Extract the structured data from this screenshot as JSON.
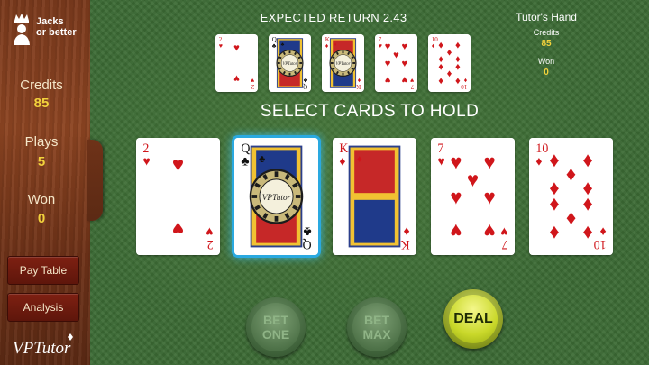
{
  "game": {
    "name_line1": "Jacks",
    "name_line2": "or better"
  },
  "sidebar": {
    "credits_label": "Credits",
    "credits_value": "85",
    "plays_label": "Plays",
    "plays_value": "5",
    "won_label": "Won",
    "won_value": "0",
    "pay_table_label": "Pay Table",
    "analysis_label": "Analysis",
    "logo_text": "VPTutor"
  },
  "top": {
    "expected_return": "EXPECTED RETURN 2.43"
  },
  "tutor": {
    "title": "Tutor's Hand",
    "credits_label": "Credits",
    "credits_value": "85",
    "won_label": "Won",
    "won_value": "0"
  },
  "prompt": "SELECT CARDS TO HOLD",
  "hand": [
    {
      "rank": "2",
      "suit": "hearts",
      "held": false
    },
    {
      "rank": "Q",
      "suit": "clubs",
      "held": true
    },
    {
      "rank": "K",
      "suit": "diamonds",
      "held": false
    },
    {
      "rank": "7",
      "suit": "hearts",
      "held": false
    },
    {
      "rank": "10",
      "suit": "diamonds",
      "held": false
    }
  ],
  "tutor_hand": [
    {
      "rank": "2",
      "suit": "hearts",
      "held": false
    },
    {
      "rank": "Q",
      "suit": "clubs",
      "held": true
    },
    {
      "rank": "K",
      "suit": "diamonds",
      "held": true
    },
    {
      "rank": "7",
      "suit": "hearts",
      "held": false
    },
    {
      "rank": "10",
      "suit": "diamonds",
      "held": false
    }
  ],
  "chip_text": "VPTutor",
  "buttons": {
    "bet_one_line1": "BET",
    "bet_one_line2": "ONE",
    "bet_max_line1": "BET",
    "bet_max_line2": "MAX",
    "deal": "DEAL"
  },
  "colors": {
    "felt": "#3b6a34",
    "wood": "#7b3a1d",
    "gold": "#f2d23c",
    "held_glow": "#2aa9e0",
    "red_suit": "#d0161b",
    "black_suit": "#111111"
  }
}
